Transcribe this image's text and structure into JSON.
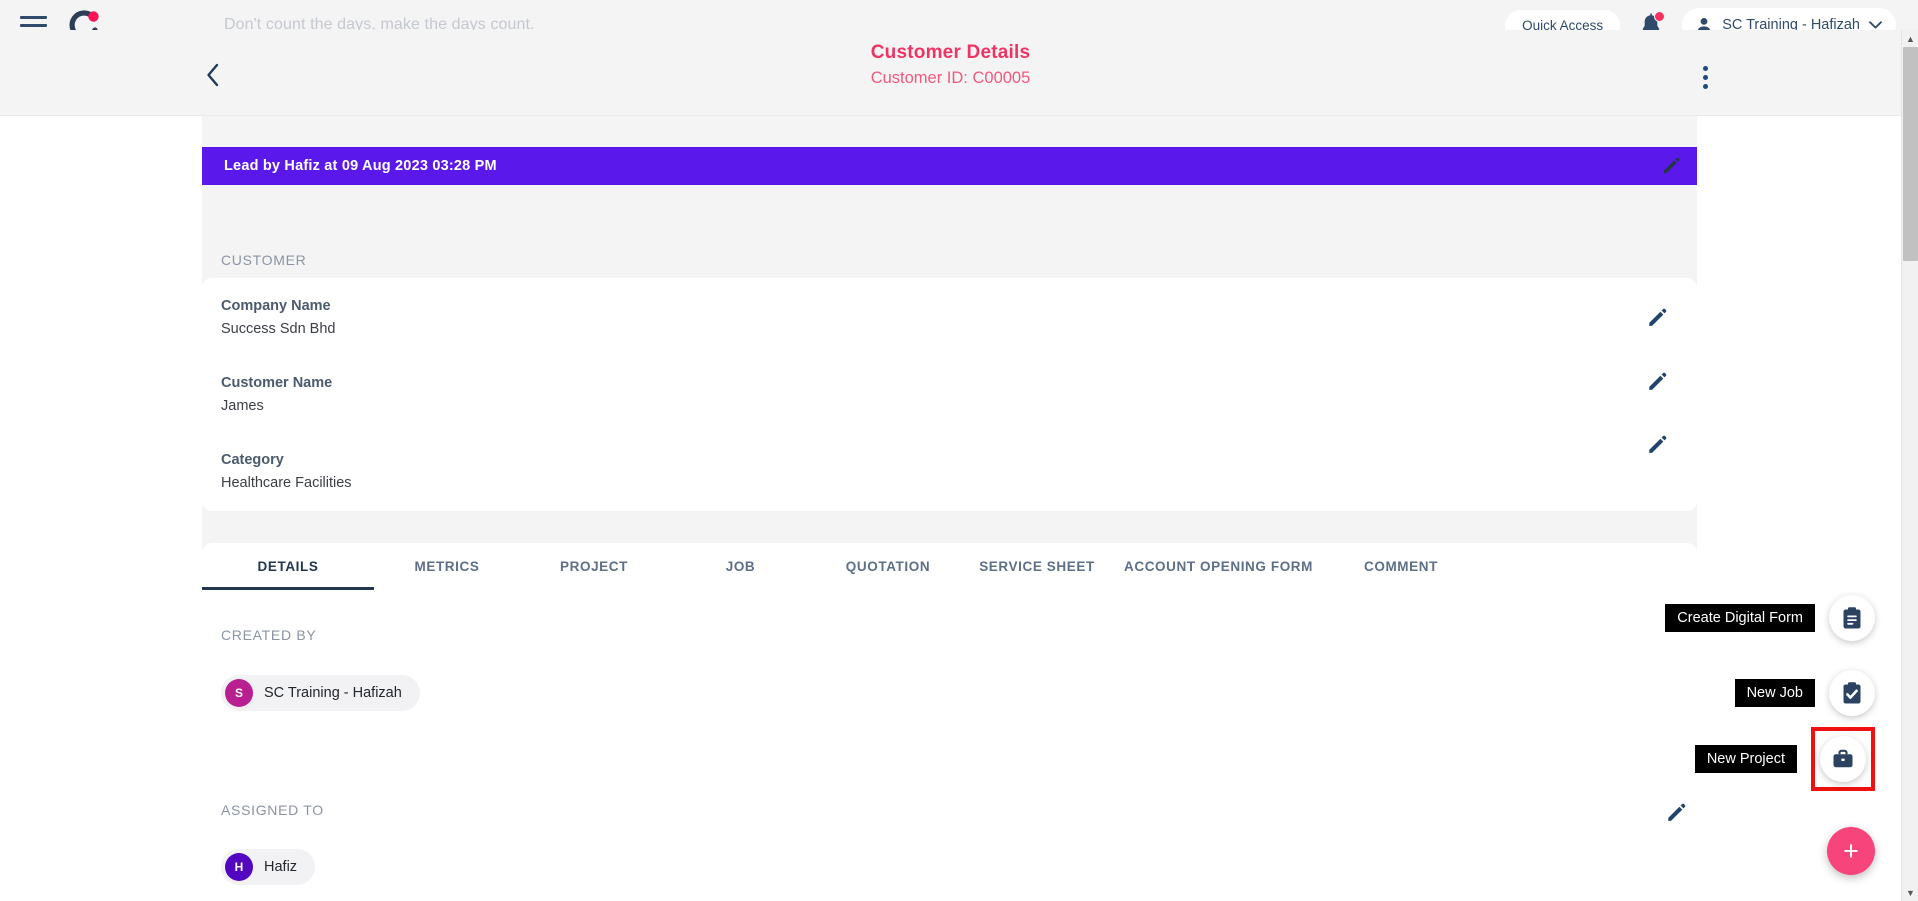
{
  "topbar": {
    "menu_icon": "hamburger-icon",
    "logo_icon": "app-logo-icon",
    "tagline": "Don't count the days, make the days count.",
    "quick_access_label": "Quick Access",
    "notification_icon": "bell-icon",
    "user_name": "SC Training - Hafizah"
  },
  "header": {
    "back_icon": "chevron-left-icon",
    "title": "Customer Details",
    "subtitle": "Customer ID: C00005",
    "kebab_icon": "more-vertical-icon"
  },
  "lead_banner": {
    "text": "Lead by Hafiz at 09 Aug 2023 03:28 PM",
    "edit_icon": "pencil-icon",
    "color": "#5a19ea"
  },
  "customer": {
    "section_label": "CUSTOMER",
    "fields": [
      {
        "label": "Company Name",
        "value": "Success Sdn Bhd"
      },
      {
        "label": "Customer Name",
        "value": "James"
      },
      {
        "label": "Category",
        "value": "Healthcare Facilities"
      }
    ]
  },
  "tabs": {
    "items": [
      {
        "label": "DETAILS",
        "active": true
      },
      {
        "label": "METRICS",
        "active": false
      },
      {
        "label": "PROJECT",
        "active": false
      },
      {
        "label": "JOB",
        "active": false
      },
      {
        "label": "QUOTATION",
        "active": false
      },
      {
        "label": "SERVICE SHEET",
        "active": false
      },
      {
        "label": "ACCOUNT OPENING FORM",
        "active": false
      },
      {
        "label": "COMMENT",
        "active": false
      }
    ],
    "active_color": "#22374f",
    "inactive_color": "#5d7087"
  },
  "details": {
    "created_by_label": "CREATED BY",
    "created_by": {
      "initial": "S",
      "name": "SC Training - Hafizah",
      "avatar_color": "#b81f90"
    },
    "assigned_to_label": "ASSIGNED TO",
    "assigned_to": {
      "initial": "H",
      "name": "Hafiz",
      "avatar_color": "#5206c0"
    },
    "assigned_edit_icon": "pencil-icon"
  },
  "fab": {
    "items": [
      {
        "tooltip": "Create Digital Form",
        "icon": "clipboard-list-icon",
        "highlighted": false
      },
      {
        "tooltip": "New Job",
        "icon": "clipboard-check-icon",
        "highlighted": false
      },
      {
        "tooltip": "New Project",
        "icon": "briefcase-icon",
        "highlighted": true
      }
    ],
    "main_label": "+",
    "main_color": "#f7447a",
    "highlight_color": "#ef1010"
  },
  "scrollbar": {
    "up_icon": "caret-up-icon",
    "down_icon": "caret-down-icon"
  }
}
